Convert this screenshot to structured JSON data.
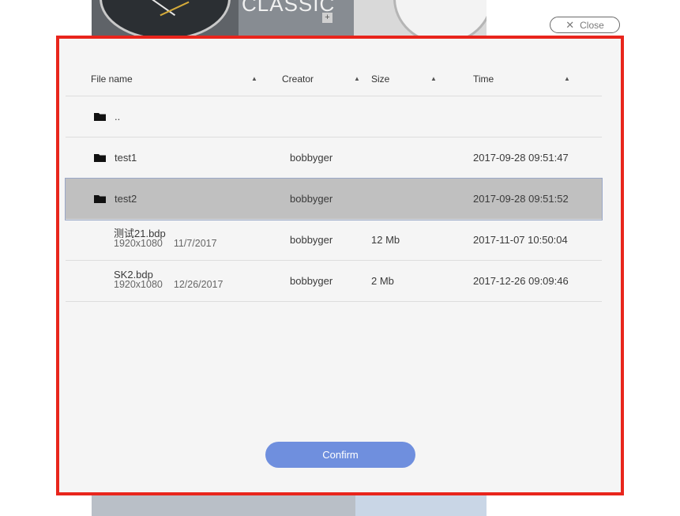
{
  "background": {
    "banner_text": "CLASSIC",
    "plus": "+"
  },
  "close": {
    "icon": "close-icon",
    "label": "Close"
  },
  "table": {
    "columns": [
      {
        "label": "File name",
        "sort_icon": "sort-icon"
      },
      {
        "label": "Creator",
        "sort_icon": "sort-icon"
      },
      {
        "label": "Size",
        "sort_icon": "sort-icon"
      },
      {
        "label": "Time",
        "sort_icon": "sort-icon"
      }
    ],
    "rows": [
      {
        "type": "folder",
        "name": "..",
        "creator": "",
        "size": "",
        "time": ""
      },
      {
        "type": "folder",
        "name": "test1",
        "creator": "bobbyger",
        "size": "",
        "time": "2017-09-28 09:51:47"
      },
      {
        "type": "folder",
        "name": "test2",
        "creator": "bobbyger",
        "size": "",
        "time": "2017-09-28 09:51:52",
        "selected": true
      },
      {
        "type": "file",
        "name": "测试21.bdp",
        "resolution": "1920x1080",
        "date": "11/7/2017",
        "creator": "bobbyger",
        "size": "12 Mb",
        "time": "2017-11-07 10:50:04"
      },
      {
        "type": "file",
        "name": "SK2.bdp",
        "resolution": "1920x1080",
        "date": "12/26/2017",
        "creator": "bobbyger",
        "size": "2 Mb",
        "time": "2017-12-26 09:09:46"
      }
    ]
  },
  "confirm": {
    "label": "Confirm"
  },
  "colors": {
    "highlight_border": "#e8251c",
    "confirm_bg": "#6f8fde",
    "selected_row": "#c0c0c0"
  }
}
